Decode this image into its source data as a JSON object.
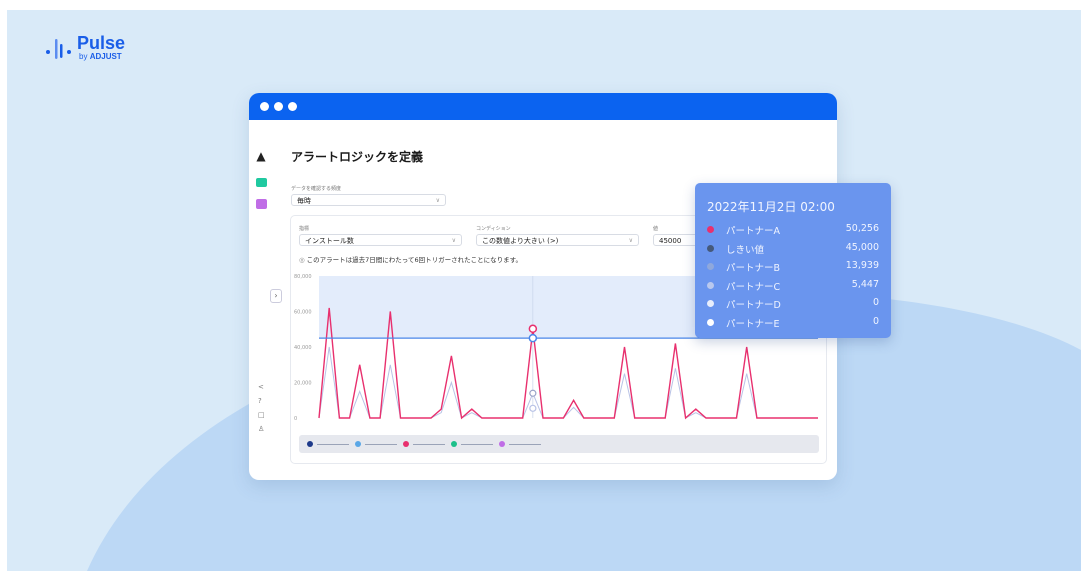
{
  "brand": {
    "name": "Pulse",
    "by_prefix": "by",
    "by_brand": "ADJUST"
  },
  "page": {
    "title": "アラートロジックを定義"
  },
  "frequency": {
    "label": "データを確認する頻度",
    "value": "毎時"
  },
  "metric": {
    "label": "指標",
    "value": "インストール数"
  },
  "condition": {
    "label": "コンディション",
    "value": "この数値より大きい (>)"
  },
  "threshold": {
    "label": "値",
    "value": "45000"
  },
  "note": {
    "text": "このアラートは過去7日間にわたって6回トリガーされたことになります。"
  },
  "colors": {
    "accent": "#0b63f0",
    "partnerA": "#e8306e",
    "threshold": "#4a86e8",
    "partnerB": "#9aa4c8",
    "partnerC": "#b7c0dd",
    "tooltip_bg": "#6a95ee"
  },
  "chart_data": {
    "type": "line",
    "ylim": [
      0,
      80000
    ],
    "yticks": [
      "80,000",
      "60,000",
      "40,000",
      "20,000",
      "0"
    ],
    "threshold": 45000,
    "series": [
      {
        "name": "パートナーA",
        "values": [
          0,
          62000,
          0,
          0,
          30000,
          0,
          0,
          60000,
          0,
          0,
          0,
          0,
          5000,
          35000,
          0,
          5000,
          0,
          0,
          0,
          0,
          0,
          50256,
          0,
          0,
          0,
          10000,
          0,
          0,
          0,
          0,
          40000,
          0,
          0,
          0,
          0,
          42000,
          0,
          5000,
          0,
          0,
          0,
          0,
          40000,
          0,
          0,
          0,
          0,
          0,
          0,
          0
        ]
      },
      {
        "name": "パートナーB",
        "values": [
          0,
          40000,
          0,
          0,
          15000,
          0,
          0,
          30000,
          0,
          0,
          0,
          0,
          3000,
          20000,
          0,
          3000,
          0,
          0,
          0,
          0,
          0,
          13939,
          0,
          0,
          0,
          6000,
          0,
          0,
          0,
          0,
          25000,
          0,
          0,
          0,
          0,
          28000,
          0,
          3000,
          0,
          0,
          0,
          0,
          25000,
          0,
          0,
          0,
          0,
          0,
          0,
          0
        ]
      }
    ]
  },
  "legend": [
    {
      "color": "#1e3a8a"
    },
    {
      "color": "#5aa7e6"
    },
    {
      "color": "#e8306e"
    },
    {
      "color": "#1cc08a"
    },
    {
      "color": "#c06de6"
    }
  ],
  "tooltip": {
    "title": "2022年11月2日 02:00",
    "rows": [
      {
        "name": "パートナーA",
        "value": "50,256",
        "color": "#e8306e"
      },
      {
        "name": "しきい値",
        "value": "45,000",
        "color": "#45597a"
      },
      {
        "name": "パートナーB",
        "value": "13,939",
        "color": "#8fa8dc"
      },
      {
        "name": "パートナーC",
        "value": "5,447",
        "color": "#b9c8ee"
      },
      {
        "name": "パートナーD",
        "value": "0",
        "color": "#e8eefc"
      },
      {
        "name": "パートナーE",
        "value": "0",
        "color": "#ffffff"
      }
    ]
  }
}
